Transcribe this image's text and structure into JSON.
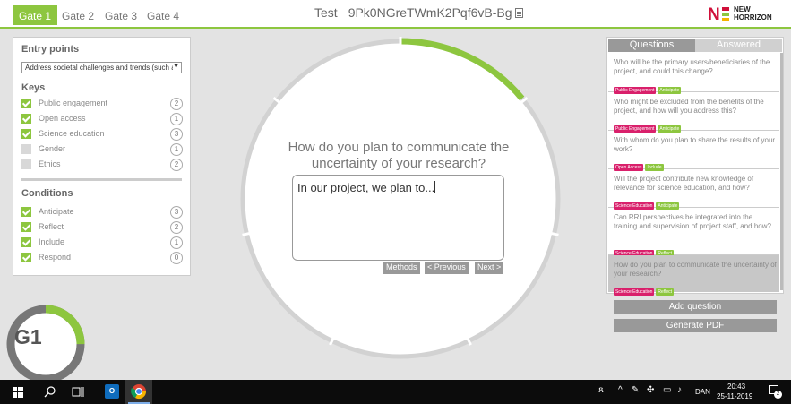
{
  "tabs": [
    {
      "label": "Gate 1",
      "active": true
    },
    {
      "label": "Gate 2",
      "active": false
    },
    {
      "label": "Gate 3",
      "active": false
    },
    {
      "label": "Gate 4",
      "active": false
    }
  ],
  "header": {
    "project_name": "Test",
    "project_code": "9Pk0NGreTWmK2Pqf6vB-Bg",
    "doc_icon": "document-icon"
  },
  "logo": {
    "letter": "N",
    "line1": "NEW",
    "line2": "HORRIZON",
    "colors": [
      "#d0103a",
      "#8dc63f",
      "#f4b400"
    ]
  },
  "left_panel": {
    "entry_points_title": "Entry points",
    "entry_select_value": "Address societal challenges and trends (such a",
    "keys_title": "Keys",
    "keys": [
      {
        "label": "Public engagement",
        "checked": true,
        "count": "2"
      },
      {
        "label": "Open access",
        "checked": true,
        "count": "1"
      },
      {
        "label": "Science education",
        "checked": true,
        "count": "3"
      },
      {
        "label": "Gender",
        "checked": false,
        "count": "1"
      },
      {
        "label": "Ethics",
        "checked": false,
        "count": "2"
      }
    ],
    "conditions_title": "Conditions",
    "conditions": [
      {
        "label": "Anticipate",
        "checked": true,
        "count": "3"
      },
      {
        "label": "Reflect",
        "checked": true,
        "count": "2"
      },
      {
        "label": "Include",
        "checked": true,
        "count": "1"
      },
      {
        "label": "Respond",
        "checked": true,
        "count": "0"
      }
    ]
  },
  "main": {
    "question": "How do you plan to communicate the uncertainty of your research?",
    "answer_value": "In our project, we plan to...",
    "progress_fraction": 0.14,
    "methods_label": "Methods",
    "previous_label": "< Previous",
    "next_label": "Next >"
  },
  "right_panel": {
    "tab_questions": "Questions",
    "tab_answered": "Answered",
    "questions": [
      {
        "text": "Who will be the primary users/beneficiaries of the project, and could this change?",
        "tags": [
          {
            "label": "Public Engagement",
            "color": "#d9206b"
          },
          {
            "label": "Anticipate",
            "color": "#8dc63f"
          }
        ],
        "selected": false
      },
      {
        "text": "Who might be excluded from the benefits of the project, and how will you address this?",
        "tags": [
          {
            "label": "Public Engagement",
            "color": "#d9206b"
          },
          {
            "label": "Anticipate",
            "color": "#8dc63f"
          }
        ],
        "selected": false
      },
      {
        "text": "With whom do you plan to share the results of your work?",
        "tags": [
          {
            "label": "Open Access",
            "color": "#d9206b"
          },
          {
            "label": "Include",
            "color": "#8dc63f"
          }
        ],
        "selected": false
      },
      {
        "text": "Will the project contribute new knowledge of relevance for science education, and how?",
        "tags": [
          {
            "label": "Science Education",
            "color": "#d9206b"
          },
          {
            "label": "Anticipate",
            "color": "#8dc63f"
          }
        ],
        "selected": false
      },
      {
        "text": "Can RRI perspectives be integrated into the training and supervision of project staff, and how?",
        "tags": [
          {
            "label": "Science Education",
            "color": "#d9206b"
          },
          {
            "label": "Reflect",
            "color": "#8dc63f"
          }
        ],
        "selected": false
      },
      {
        "text": "How do you plan to communicate the uncertainty of your research?",
        "tags": [
          {
            "label": "Science Education",
            "color": "#d9206b"
          },
          {
            "label": "Reflect",
            "color": "#8dc63f"
          }
        ],
        "selected": true
      }
    ],
    "add_question_label": "Add question",
    "generate_pdf_label": "Generate PDF"
  },
  "gate_badge": {
    "label": "G1",
    "progress_fraction": 0.25
  },
  "taskbar": {
    "icons": [
      "windows-start-icon",
      "search-icon",
      "task-view-icon",
      "outlook-icon",
      "chrome-icon"
    ],
    "language": "DAN",
    "time": "20:43",
    "date": "25-11-2019",
    "notification_count": "2"
  },
  "colors": {
    "accent": "#8dc63f",
    "tag_pink": "#d9206b",
    "button_grey": "#999999"
  }
}
